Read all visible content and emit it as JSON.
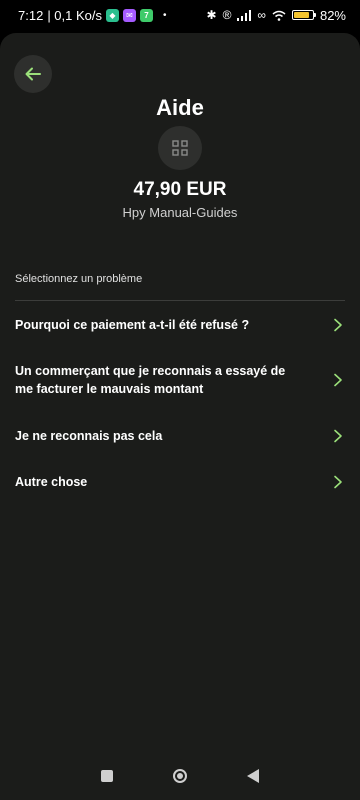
{
  "status_bar": {
    "time": "7:12",
    "network_speed": "| 0,1 Ko/s",
    "battery": "82%",
    "battery_level": 0.82,
    "app_icons": [
      "shield-app-icon",
      "messenger-icon",
      "app-7-icon"
    ]
  },
  "header": {
    "title": "Aide"
  },
  "transaction": {
    "amount": "47,90 EUR",
    "merchant": "Hpy Manual-Guides"
  },
  "help": {
    "section_label": "Sélectionnez un problème",
    "options": [
      {
        "label": "Pourquoi ce paiement a-t-il été refusé ?"
      },
      {
        "label": "Un commerçant que je reconnais a essayé de me facturer le mauvais montant"
      },
      {
        "label": "Je ne reconnais pas cela"
      },
      {
        "label": "Autre chose"
      }
    ]
  },
  "colors": {
    "accent": "#9be07a",
    "sheet_bg": "#1b1c1a"
  }
}
